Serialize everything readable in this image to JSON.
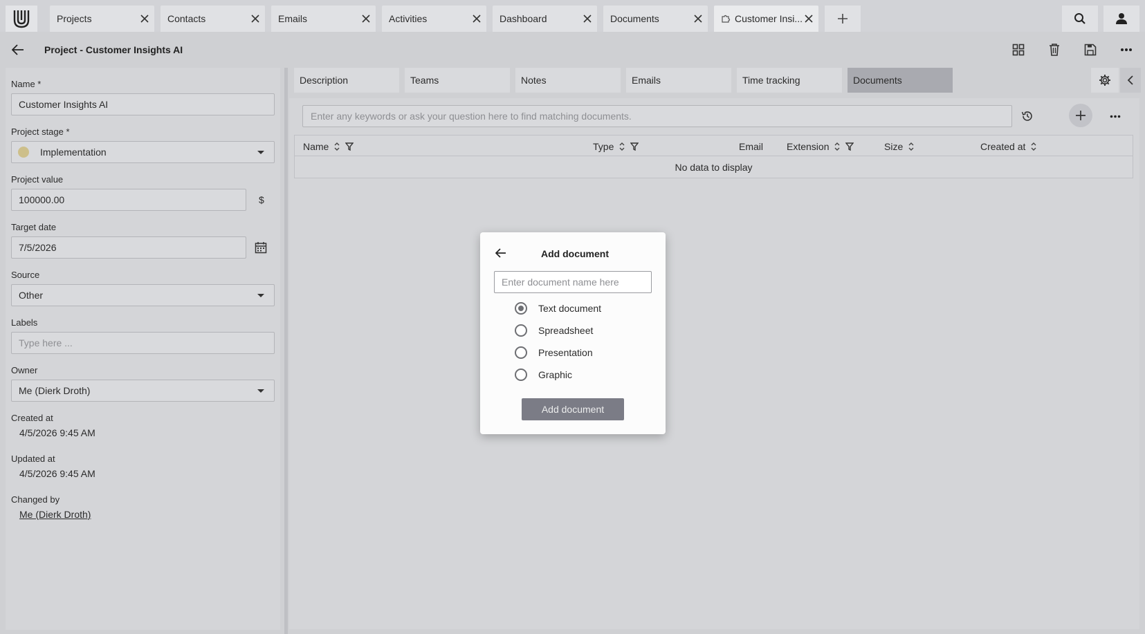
{
  "tabs": [
    {
      "label": "Projects"
    },
    {
      "label": "Contacts"
    },
    {
      "label": "Emails"
    },
    {
      "label": "Activities"
    },
    {
      "label": "Dashboard"
    },
    {
      "label": "Documents"
    },
    {
      "label": "Customer Insi..."
    }
  ],
  "header": {
    "title": "Project - Customer Insights AI"
  },
  "form": {
    "name_label": "Name *",
    "name_value": "Customer Insights AI",
    "stage_label": "Project stage *",
    "stage_value": "Implementation",
    "stage_color": "#cdbf8a",
    "value_label": "Project value",
    "value_value": "100000.00",
    "currency": "$",
    "date_label": "Target date",
    "date_value": "7/5/2026",
    "source_label": "Source",
    "source_value": "Other",
    "labels_label": "Labels",
    "labels_placeholder": "Type here ...",
    "owner_label": "Owner",
    "owner_value": "Me (Dierk Droth)",
    "created_label": "Created at",
    "created_value": "4/5/2026 9:45 AM",
    "updated_label": "Updated at",
    "updated_value": "4/5/2026 9:45 AM",
    "changed_label": "Changed by",
    "changed_value": "Me (Dierk Droth)"
  },
  "subtabs": [
    {
      "label": "Description"
    },
    {
      "label": "Teams"
    },
    {
      "label": "Notes"
    },
    {
      "label": "Emails"
    },
    {
      "label": "Time tracking"
    },
    {
      "label": "Documents",
      "active": true
    }
  ],
  "documents": {
    "search_placeholder": "Enter any keywords or ask your question here to find matching documents.",
    "columns": {
      "name": "Name",
      "type": "Type",
      "email": "Email",
      "extension": "Extension",
      "size": "Size",
      "created": "Created at"
    },
    "empty_text": "No data to display"
  },
  "dialog": {
    "title": "Add document",
    "input_placeholder": "Enter document name here",
    "options": [
      {
        "label": "Text document",
        "selected": true
      },
      {
        "label": "Spreadsheet",
        "selected": false
      },
      {
        "label": "Presentation",
        "selected": false
      },
      {
        "label": "Graphic",
        "selected": false
      }
    ],
    "submit_label": "Add document"
  },
  "colors": {
    "active_subtab": "#a9aab0",
    "submit_button": "#7b7c86",
    "background": "#cfd0d3"
  }
}
